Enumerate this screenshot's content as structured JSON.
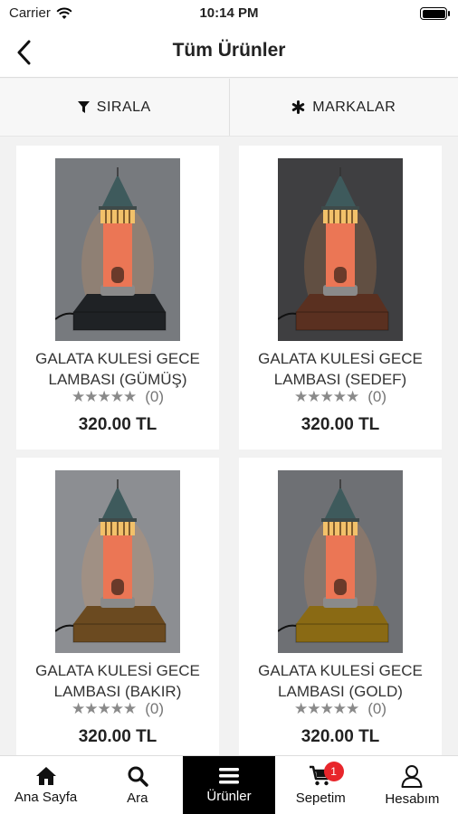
{
  "status_bar": {
    "carrier": "Carrier",
    "time": "10:14 PM"
  },
  "header": {
    "title": "Tüm Ürünler"
  },
  "filters": {
    "sort_label": "SIRALA",
    "brands_label": "MARKALAR"
  },
  "products": [
    {
      "name": "GALATA KULESİ GECE LAMBASI (GÜMÜŞ)",
      "rating_count": "(0)",
      "price": "320.00 TL",
      "base_color": "#1f2225",
      "bg_color": "#777a7e"
    },
    {
      "name": "GALATA KULESİ GECE LAMBASI (SEDEF)",
      "rating_count": "(0)",
      "price": "320.00 TL",
      "base_color": "#5a3020",
      "bg_color": "#3f3f41"
    },
    {
      "name": "GALATA KULESİ GECE LAMBASI (BAKIR)",
      "rating_count": "(0)",
      "price": "320.00 TL",
      "base_color": "#6b4a20",
      "bg_color": "#8c8e92"
    },
    {
      "name": "GALATA KULESİ GECE LAMBASI (GOLD)",
      "rating_count": "(0)",
      "price": "320.00 TL",
      "base_color": "#8a6a14",
      "bg_color": "#6e7074"
    }
  ],
  "tabs": [
    {
      "label": "Ana Sayfa",
      "icon": "home-icon"
    },
    {
      "label": "Ara",
      "icon": "search-icon"
    },
    {
      "label": "Ürünler",
      "icon": "menu-icon"
    },
    {
      "label": "Sepetim",
      "icon": "cart-icon",
      "badge": "1"
    },
    {
      "label": "Hesabım",
      "icon": "user-icon"
    }
  ]
}
